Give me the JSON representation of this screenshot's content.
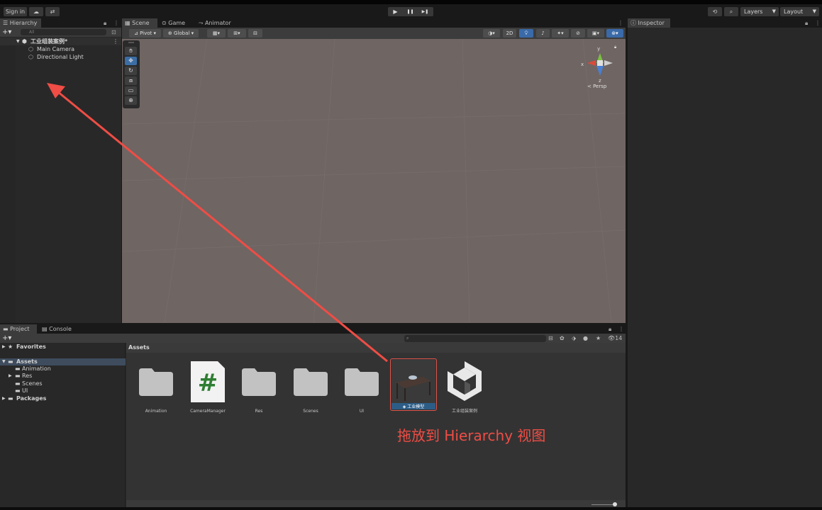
{
  "toolbar": {
    "sign_in": "Sign in",
    "layers": "Layers",
    "layout": "Layout",
    "play": "▶",
    "pause": "❚❚",
    "step": "▶❚"
  },
  "hierarchy": {
    "tab": "Hierarchy",
    "search_placeholder": "All",
    "scene_name": "工业组装案例*",
    "items": [
      "Main Camera",
      "Directional Light"
    ]
  },
  "scene": {
    "tabs": [
      "Scene",
      "Game",
      "Animator"
    ],
    "pivot": "Pivot",
    "global": "Global",
    "mode_2d": "2D",
    "persp": "< Persp",
    "axis_x": "x",
    "axis_y": "y",
    "axis_z": "z"
  },
  "inspector": {
    "tab": "Inspector"
  },
  "project": {
    "tabs": [
      "Project",
      "Console"
    ],
    "hidden_count": "14",
    "tree": {
      "favorites": "Favorites",
      "assets": "Assets",
      "children": [
        "Animation",
        "Res",
        "Scenes",
        "UI"
      ],
      "packages": "Packages"
    },
    "breadcrumb": "Assets",
    "assets": [
      {
        "label": "Animation",
        "kind": "folder"
      },
      {
        "label": "CameraManager",
        "kind": "script"
      },
      {
        "label": "Res",
        "kind": "folder"
      },
      {
        "label": "Scenes",
        "kind": "folder"
      },
      {
        "label": "UI",
        "kind": "folder"
      },
      {
        "label": "工业模型",
        "kind": "model"
      },
      {
        "label": "工业组装案例",
        "kind": "unity-scene"
      }
    ]
  },
  "annotation": {
    "text": "拖放到 Hierarchy 视图",
    "color": "#ef4d45"
  },
  "colors": {
    "viewport": "#6f6563",
    "panel": "#282828",
    "selection": "#2c5d87",
    "accent": "#3b6ea5"
  }
}
